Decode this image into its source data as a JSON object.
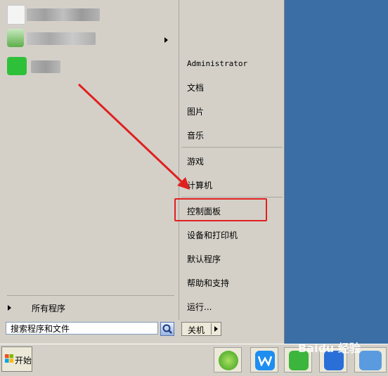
{
  "right_pane": {
    "items": [
      {
        "label": "Administrator",
        "name": "user-name"
      },
      {
        "label": "文档",
        "name": "menu-item-documents"
      },
      {
        "label": "图片",
        "name": "menu-item-pictures"
      },
      {
        "label": "音乐",
        "name": "menu-item-music"
      },
      {
        "label": "游戏",
        "name": "menu-item-games"
      },
      {
        "label": "计算机",
        "name": "menu-item-computer"
      },
      {
        "label": "控制面板",
        "name": "menu-item-control-panel"
      },
      {
        "label": "设备和打印机",
        "name": "menu-item-devices-printers"
      },
      {
        "label": "默认程序",
        "name": "menu-item-default-programs"
      },
      {
        "label": "帮助和支持",
        "name": "menu-item-help-support"
      },
      {
        "label": "运行...",
        "name": "menu-item-run"
      }
    ]
  },
  "left_pane": {
    "all_programs": "所有程序",
    "search_placeholder": "搜索程序和文件"
  },
  "shutdown": {
    "label": "关机"
  },
  "taskbar": {
    "start_label": "开始",
    "watermark": "Baidu 经验"
  },
  "colors": {
    "desktop": "#3a6ea5",
    "highlight_box": "#e02020",
    "annotation_arrow": "#e02020"
  }
}
